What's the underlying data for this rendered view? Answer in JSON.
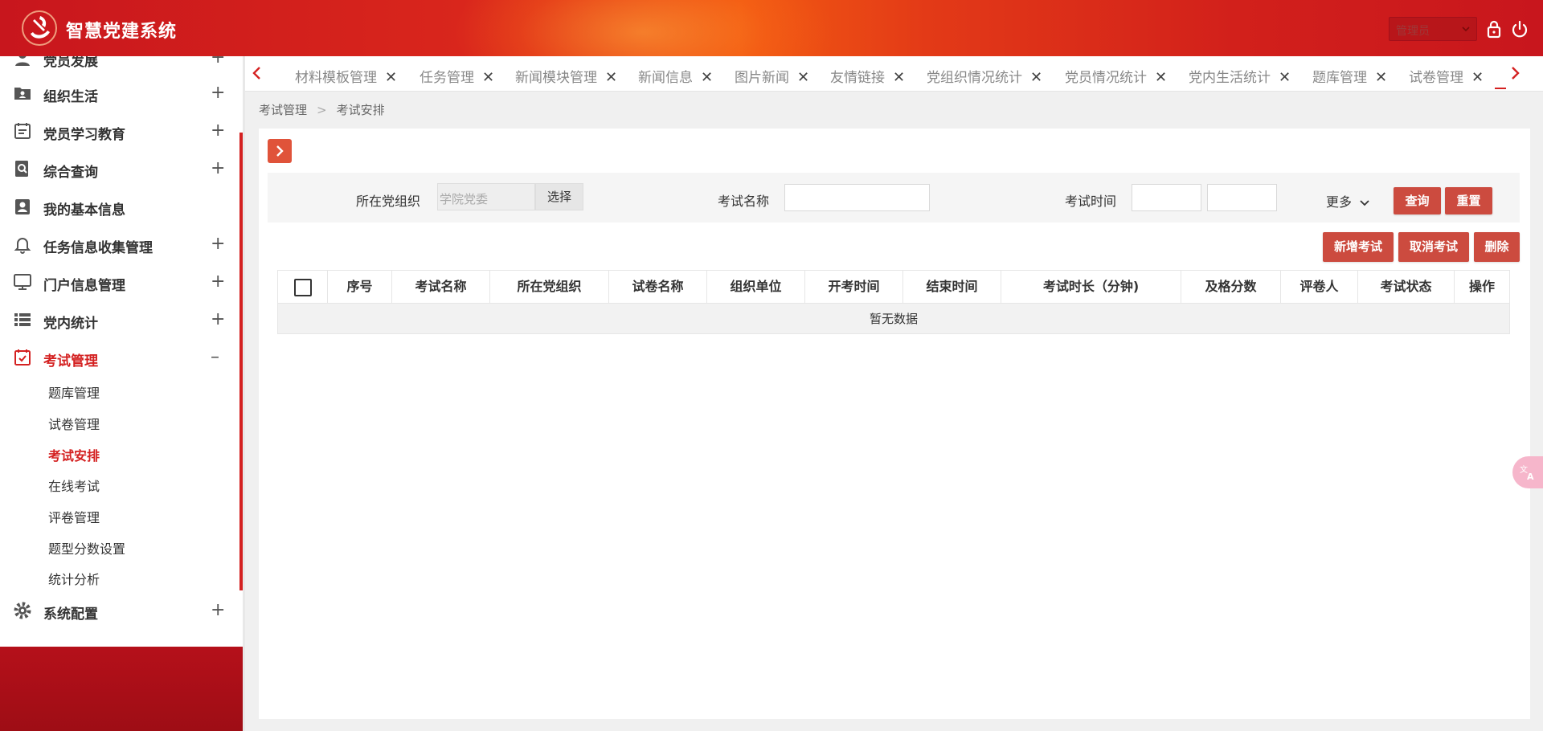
{
  "header": {
    "title": "智慧党建系统",
    "role_value": "管理员"
  },
  "sidebar": {
    "top_partial": "党员发展",
    "items": [
      {
        "label": "组织生活",
        "toggle": "+"
      },
      {
        "label": "党员学习教育",
        "toggle": "+"
      },
      {
        "label": "综合查询",
        "toggle": "+"
      },
      {
        "label": "我的基本信息",
        "toggle": ""
      },
      {
        "label": "任务信息收集管理",
        "toggle": "+"
      },
      {
        "label": "门户信息管理",
        "toggle": "+"
      },
      {
        "label": "党内统计",
        "toggle": "+"
      },
      {
        "label": "考试管理",
        "toggle": "–"
      },
      {
        "label": "系统配置",
        "toggle": "+"
      }
    ],
    "submenu": [
      "题库管理",
      "试卷管理",
      "考试安排",
      "在线考试",
      "评卷管理",
      "题型分数设置",
      "统计分析"
    ],
    "active_submenu": "考试安排"
  },
  "tabs": [
    {
      "label": "材料模板管理"
    },
    {
      "label": "任务管理"
    },
    {
      "label": "新闻模块管理"
    },
    {
      "label": "新闻信息"
    },
    {
      "label": "图片新闻"
    },
    {
      "label": "友情链接"
    },
    {
      "label": "党组织情况统计"
    },
    {
      "label": "党员情况统计"
    },
    {
      "label": "党内生活统计"
    },
    {
      "label": "题库管理"
    },
    {
      "label": "试卷管理"
    }
  ],
  "tab_close": "✕",
  "breadcrumb": {
    "parent": "考试管理",
    "sep": ">",
    "current": "考试安排"
  },
  "filter": {
    "org_label": "所在党组织",
    "org_value": "学院党委",
    "choose_label": "选择",
    "exam_name_label": "考试名称",
    "exam_name_value": "",
    "exam_time_label": "考试时间",
    "more_label": "更多",
    "query_label": "查询",
    "reset_label": "重置"
  },
  "actions": {
    "add": "新增考试",
    "cancel": "取消考试",
    "delete": "删除"
  },
  "table": {
    "columns": [
      "序号",
      "考试名称",
      "所在党组织",
      "试卷名称",
      "组织单位",
      "开考时间",
      "结束时间",
      "考试时长（分钟)",
      "及格分数",
      "评卷人",
      "考试状态",
      "操作"
    ],
    "empty_text": "暂无数据"
  },
  "colors": {
    "brand_red": "#d42121",
    "button_red": "#cc4b3f"
  }
}
